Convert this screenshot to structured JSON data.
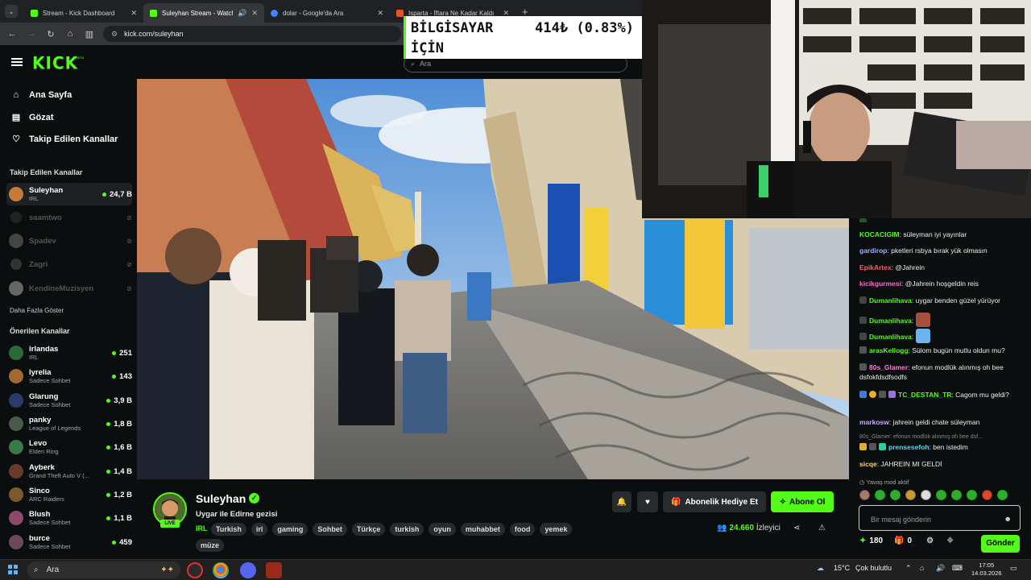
{
  "browser": {
    "tabs": [
      {
        "title": "Stream - Kick Dashboard",
        "favicon_color": "#53fc18"
      },
      {
        "title": "Suleyhan Stream - Watch Live on Kick",
        "favicon_color": "#53fc18"
      },
      {
        "title": "dolar - Google'da Ara",
        "favicon_color": "#4285f4"
      },
      {
        "title": "Isparta - İftara Ne Kadar Kaldı",
        "favicon_color": "#e0572a"
      }
    ],
    "url": "kick.com/suleyhan"
  },
  "ticker": {
    "line1": "BİLGİSAYAR",
    "line2": "İÇİN",
    "value": "414₺ (0.83%)"
  },
  "header": {
    "logo": "KICK",
    "beta": "BETA",
    "search_placeholder": "Ara"
  },
  "sidebar": {
    "nav": [
      {
        "label": "Ana Sayfa",
        "icon": "home-icon"
      },
      {
        "label": "Gözat",
        "icon": "browse-icon"
      },
      {
        "label": "Takip Edilen Kanallar",
        "icon": "heart-icon"
      }
    ],
    "followed_title": "Takip Edilen Kanallar",
    "followed": [
      {
        "name": "Suleyhan",
        "sub": "IRL",
        "viewers": "24,7 B",
        "online": true,
        "color": "#c57a3a"
      },
      {
        "name": "saamtwo",
        "sub": "",
        "viewers": "",
        "online": false,
        "color": "#333"
      },
      {
        "name": "Spadev",
        "sub": "",
        "viewers": "",
        "online": false,
        "color": "#444"
      },
      {
        "name": "Zagri",
        "sub": "",
        "viewers": "",
        "online": false,
        "color": "#333"
      },
      {
        "name": "KendineMuzisyen",
        "sub": "",
        "viewers": "",
        "online": false,
        "color": "#555"
      }
    ],
    "show_more": "Daha Fazla Göster",
    "recommended_title": "Önerilen Kanallar",
    "recommended": [
      {
        "name": "irlandas",
        "sub": "IRL",
        "viewers": "251",
        "color": "#2a6a3a"
      },
      {
        "name": "lyrelia",
        "sub": "Sadece Sohbet",
        "viewers": "143",
        "color": "#a06a30"
      },
      {
        "name": "Glarung",
        "sub": "Sadece Sohbet",
        "viewers": "3,9 B",
        "color": "#2a3a6a"
      },
      {
        "name": "panky",
        "sub": "League of Legends",
        "viewers": "1,8 B",
        "color": "#4a5a4a"
      },
      {
        "name": "Levo",
        "sub": "Elden Ring",
        "viewers": "1,6 B",
        "color": "#3a7a4a"
      },
      {
        "name": "Ayberk",
        "sub": "Grand Theft Auto V (...",
        "viewers": "1,4 B",
        "color": "#6a3a2a"
      },
      {
        "name": "Sinco",
        "sub": "ARC Raiders",
        "viewers": "1,2 B",
        "color": "#7a5a2a"
      },
      {
        "name": "Blush",
        "sub": "Sadece Sohbet",
        "viewers": "1,1 B",
        "color": "#8a4a6a"
      },
      {
        "name": "burce",
        "sub": "Sadece Sohbet",
        "viewers": "459",
        "color": "#6a4a5a"
      }
    ]
  },
  "stream": {
    "name": "Suleyhan",
    "live": "LIVE",
    "title": "Uygar ile Edirne gezisi",
    "category": "IRL",
    "tags": [
      "Turkish",
      "irl",
      "gaming",
      "Sohbet",
      "Türkçe",
      "turkish",
      "oyun",
      "muhabbet",
      "food",
      "yemek",
      "müze"
    ],
    "gift_label": "Abonelik Hediye Et",
    "subscribe_label": "Abone Ol",
    "viewers": "24.660",
    "viewers_suffix": "İzleyici"
  },
  "chat": {
    "messages": [
      {
        "user": "KOCACIGIM",
        "color": "#53fc18",
        "text": "süleyman iyi yayınlar"
      },
      {
        "user": "gardirop",
        "color": "#9fb0ff",
        "text": "pketleri rsbya bırak yük olmasın"
      },
      {
        "user": "EpikArtex",
        "color": "#ff5c5c",
        "text": "@Jahrein"
      },
      {
        "user": "kicikgurmesi",
        "color": "#ff6ad5",
        "text": "@Jahrein hoşgeldin reis"
      },
      {
        "user": "Dumanlihava",
        "color": "#53fc18",
        "text": "uygar benden güzel yürüyor"
      },
      {
        "user": "Dumanlihava",
        "color": "#53fc18",
        "text": ""
      },
      {
        "user": "Dumanlihava",
        "color": "#53fc18",
        "text": ""
      },
      {
        "user": "arasKellogg",
        "color": "#53fc18",
        "text": "Sülom bugün mutlu oldun mu?"
      },
      {
        "user": "80s_Glamer",
        "color": "#ff7ad9",
        "text": "efonun modlük alınmış oh bee dsfokfdsdfsodfs"
      },
      {
        "user": "TC_DESTAN_TR",
        "color": "#53fc18",
        "text": "Cagom mu geldi?"
      },
      {
        "user": "markosw",
        "color": "#c9a8ff",
        "text": "jahrein geldi chate süleyman"
      },
      {
        "user": "prensesefoh",
        "color": "#4fd7ff",
        "text": "ben istedim"
      },
      {
        "user": "sicqe",
        "color": "#ffd36b",
        "text": "JAHREIN MI GELDİ"
      }
    ],
    "reply_preview": "80s_Glamer: efonun modlük alınmış oh bee dsf...",
    "slow_mode": "Yavaş mod aktif",
    "input_placeholder": "Bir mesaj gönderin",
    "points": "180",
    "gifts": "0",
    "send_label": "Gönder"
  },
  "taskbar": {
    "search": "Ara",
    "temperature": "15°C",
    "weather": "Çok bulutlu",
    "time": "17:05",
    "date": "14.03.2026"
  }
}
